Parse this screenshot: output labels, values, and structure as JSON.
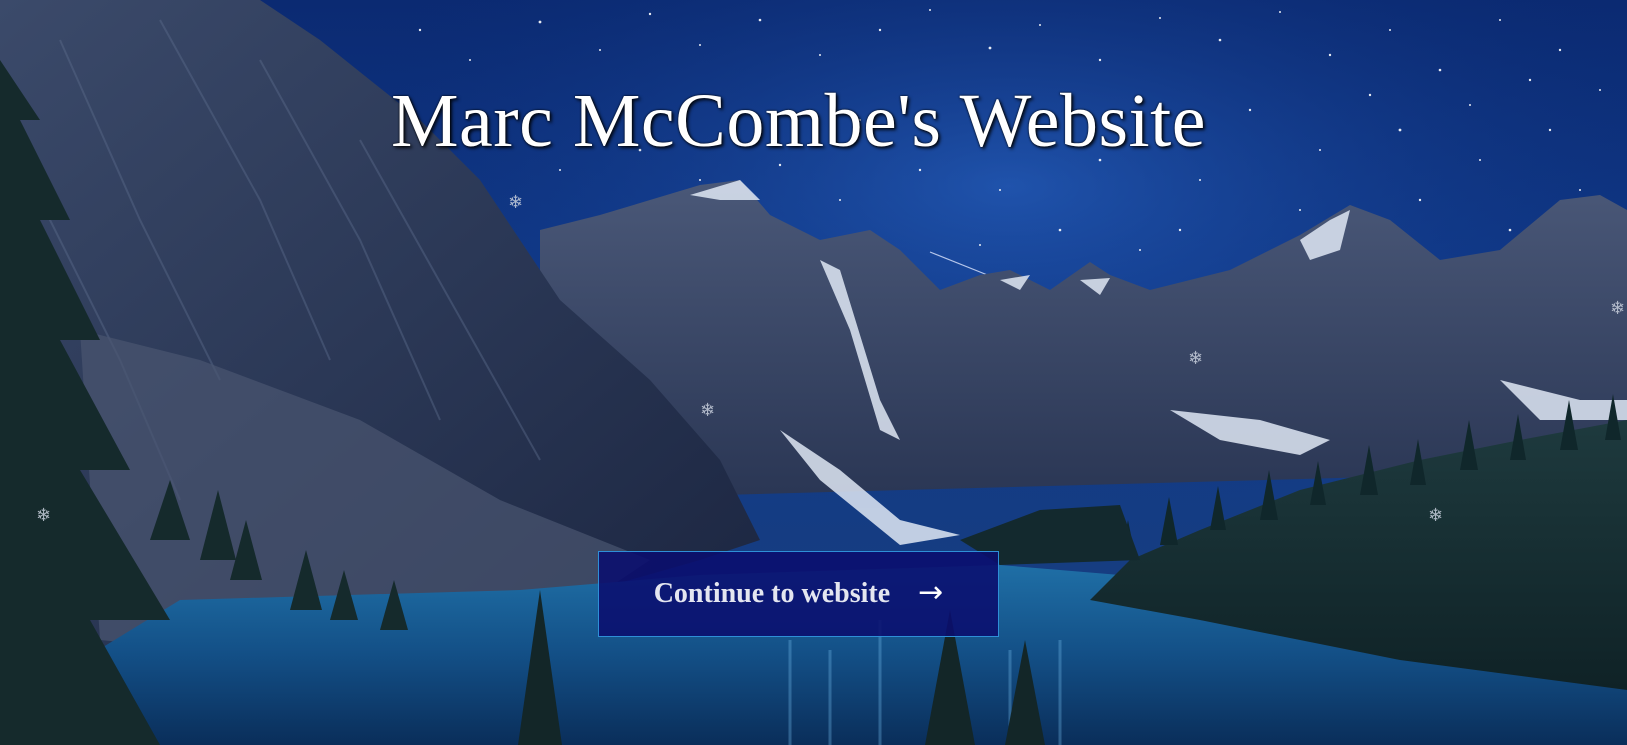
{
  "header": {
    "title": "Marc McCombe's Website"
  },
  "cta": {
    "label": "Continue to website",
    "icon": "arrow-right-icon",
    "glyph": "→"
  },
  "decorations": {
    "snowflake_icon": "snowflake-icon",
    "snowflake_glyph": "❄"
  },
  "colors": {
    "sky": "#0a2a6e",
    "button_bg": "#0a0e6e",
    "button_border": "#2e8fd8",
    "title": "#ffffff"
  }
}
